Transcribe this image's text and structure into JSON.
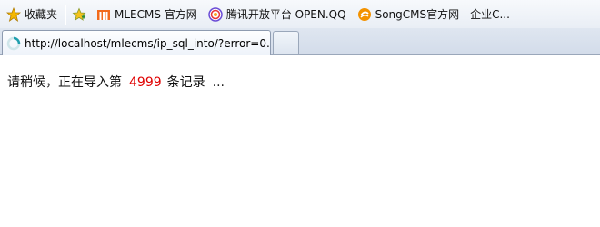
{
  "bookmarks": [
    {
      "label": "收藏夹",
      "icon": "star-icon"
    },
    {
      "label": "MLECMS 官方网",
      "icon": "mlecms-logo-icon"
    },
    {
      "label": "腾讯开放平台 OPEN.QQ",
      "icon": "tencent-open-icon"
    },
    {
      "label": "SongCMS官方网 - 企业C...",
      "icon": "songcms-logo-icon"
    }
  ],
  "tab": {
    "title": "http://localhost/mlecms/ip_sql_into/?error=0...",
    "icon": "loading-icon"
  },
  "content": {
    "prefix": "请稍候，正在导入第",
    "count": "4999",
    "suffix": "条记录",
    "ellipsis": "..."
  },
  "colors": {
    "count": "#e00000",
    "accent": "#f5a623"
  }
}
